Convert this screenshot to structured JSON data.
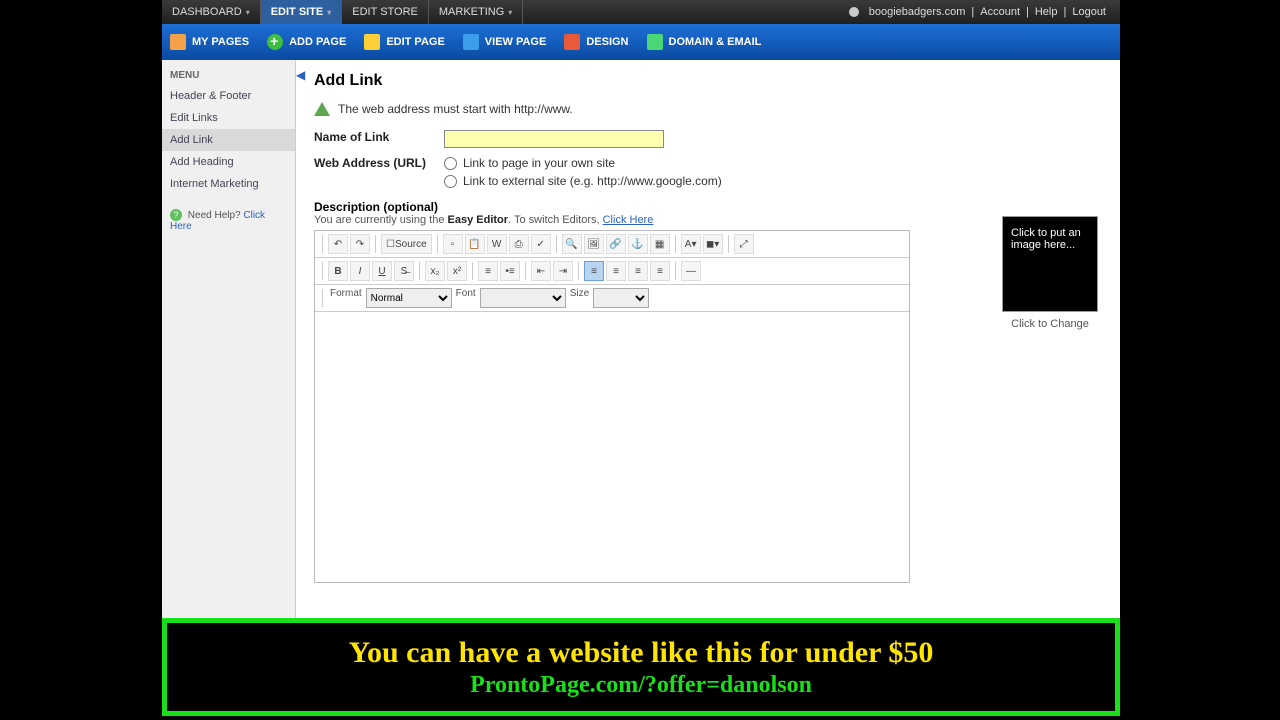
{
  "topnav": {
    "tabs": [
      "DASHBOARD",
      "EDIT SITE",
      "EDIT STORE",
      "MARKETING"
    ],
    "active_index": 1,
    "domain": "boogiebadgers.com",
    "links": [
      "Account",
      "Help",
      "Logout"
    ]
  },
  "toolbar": {
    "items": [
      "MY PAGES",
      "ADD PAGE",
      "EDIT PAGE",
      "VIEW PAGE",
      "DESIGN",
      "DOMAIN & EMAIL"
    ]
  },
  "sidebar": {
    "header": "MENU",
    "items": [
      "Header & Footer",
      "Edit Links",
      "Add Link",
      "Add Heading",
      "Internet Marketing"
    ],
    "active_index": 2,
    "help_text": "Need Help?",
    "help_link": "Click Here"
  },
  "page": {
    "title": "Add Link",
    "warning": "The web address must start with http://www.",
    "name_label": "Name of Link",
    "name_value": "",
    "url_label": "Web Address (URL)",
    "radio1": "Link to page in your own site",
    "radio2": "Link to external site (e.g. http://www.google.com)",
    "desc_label": "Description (optional)",
    "desc_sub_pre": "You are currently using the ",
    "desc_sub_bold": "Easy Editor",
    "desc_sub_post": ". To switch Editors, ",
    "desc_sub_link": "Click Here"
  },
  "editor": {
    "source": "Source",
    "format_label": "Format",
    "format_value": "Normal",
    "font_label": "Font",
    "size_label": "Size"
  },
  "imagebox": {
    "placeholder": "Click to put an image here...",
    "caption": "Click to Change"
  },
  "promo": {
    "line1": "You can have a website like this for under $50",
    "line2": "ProntoPage.com/?offer=danolson"
  }
}
